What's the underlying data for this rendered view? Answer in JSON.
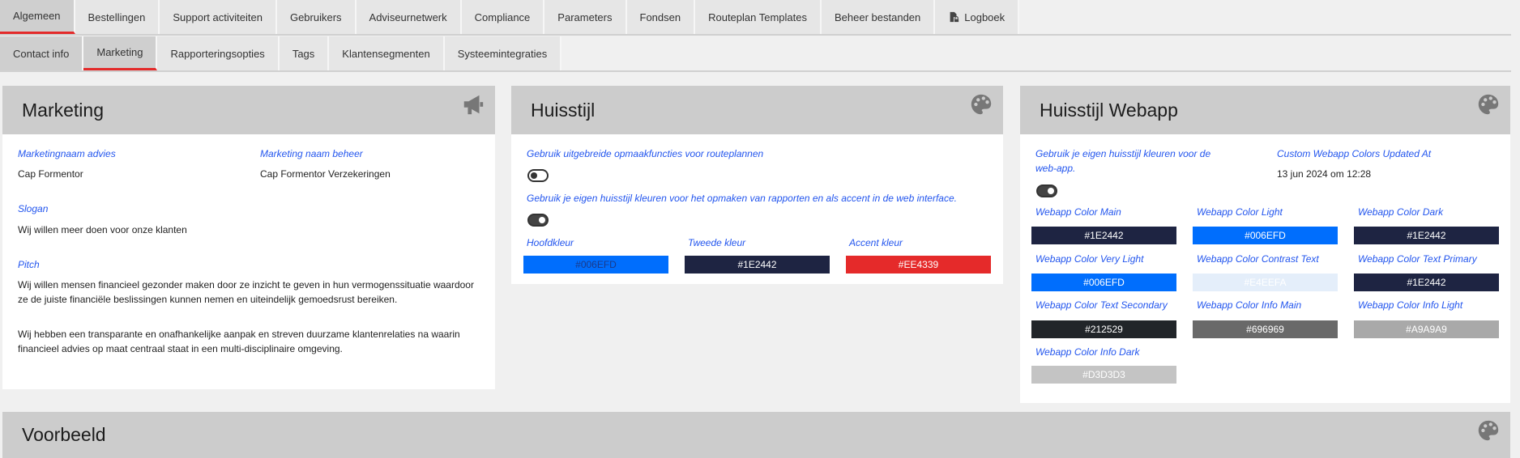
{
  "main_tabs": [
    "Algemeen",
    "Bestellingen",
    "Support activiteiten",
    "Gebruikers",
    "Adviseurnetwerk",
    "Compliance",
    "Parameters",
    "Fondsen",
    "Routeplan Templates",
    "Beheer bestanden",
    "Logboek"
  ],
  "sub_tabs": [
    "Contact info",
    "Marketing",
    "Rapporteringsopties",
    "Tags",
    "Klantensegmenten",
    "Systeemintegraties"
  ],
  "marketing": {
    "title": "Marketing",
    "naam_advies_label": "Marketingnaam advies",
    "naam_advies_value": "Cap Formentor",
    "naam_beheer_label": "Marketing naam beheer",
    "naam_beheer_value": "Cap Formentor Verzekeringen",
    "slogan_label": "Slogan",
    "slogan_value": "Wij willen meer doen voor onze klanten",
    "pitch_label": "Pitch",
    "pitch_p1": "Wij willen mensen financieel gezonder maken door ze inzicht te geven in hun vermogenssituatie waardoor ze de juiste financiële beslissingen kunnen nemen en uiteindelijk gemoedsrust bereiken.",
    "pitch_p2": "Wij hebben een transparante en onafhankelijke aanpak en streven duurzame klantenrelaties na waarin financieel advies op maat centraal staat in een multi-disciplinaire omgeving."
  },
  "huisstijl": {
    "title": "Huisstijl",
    "opt1_label": "Gebruik uitgebreide opmaakfuncties voor routeplannen",
    "opt1_on": false,
    "opt2_label": "Gebruik je eigen huisstijl kleuren voor het opmaken van rapporten en als accent in de web interface.",
    "opt2_on": true,
    "colors": [
      {
        "label": "Hoofdkleur",
        "value": "#006EFD",
        "bg": "#006EFD",
        "fg": "#1a3a8a"
      },
      {
        "label": "Tweede kleur",
        "value": "#1E2442",
        "bg": "#1E2442",
        "fg": "#ffffff"
      },
      {
        "label": "Accent kleur",
        "value": "#EE4339",
        "bg": "#E52A2A",
        "fg": "#ffffff"
      }
    ]
  },
  "webapp": {
    "title": "Huisstijl Webapp",
    "own_label": "Gebruik je eigen huisstijl kleuren voor de web-app.",
    "own_on": true,
    "updated_label": "Custom Webapp Colors Updated At",
    "updated_value": "13 jun 2024 om 12:28",
    "colors": [
      {
        "label": "Webapp Color Main",
        "value": "#1E2442",
        "bg": "#1E2442",
        "fg": "#ffffff"
      },
      {
        "label": "Webapp Color Light",
        "value": "#006EFD",
        "bg": "#006EFD",
        "fg": "#ffffff"
      },
      {
        "label": "Webapp Color Dark",
        "value": "#1E2442",
        "bg": "#1E2442",
        "fg": "#ffffff"
      },
      {
        "label": "Webapp Color Very Light",
        "value": "#006EFD",
        "bg": "#006EFD",
        "fg": "#ffffff"
      },
      {
        "label": "Webapp Color Contrast Text",
        "value": "#E4EEFA",
        "bg": "#E4EEFA",
        "fg": "#ffffff"
      },
      {
        "label": "Webapp Color Text Primary",
        "value": "#1E2442",
        "bg": "#1E2442",
        "fg": "#ffffff"
      },
      {
        "label": "Webapp Color Text Secondary",
        "value": "#212529",
        "bg": "#212529",
        "fg": "#ffffff"
      },
      {
        "label": "Webapp Color Info Main",
        "value": "#696969",
        "bg": "#696969",
        "fg": "#ffffff"
      },
      {
        "label": "Webapp Color Info Light",
        "value": "#A9A9A9",
        "bg": "#A9A9A9",
        "fg": "#ffffff"
      },
      {
        "label": "Webapp Color Info Dark",
        "value": "#D3D3D3",
        "bg": "#C4C4C4",
        "fg": "#ffffff"
      }
    ]
  },
  "voorbeeld": {
    "title": "Voorbeeld"
  },
  "icons": {
    "marketing": "megaphone-icon",
    "palette": "palette-icon",
    "logboek": "file-lock-icon"
  },
  "accent_color": "#E32A2A"
}
